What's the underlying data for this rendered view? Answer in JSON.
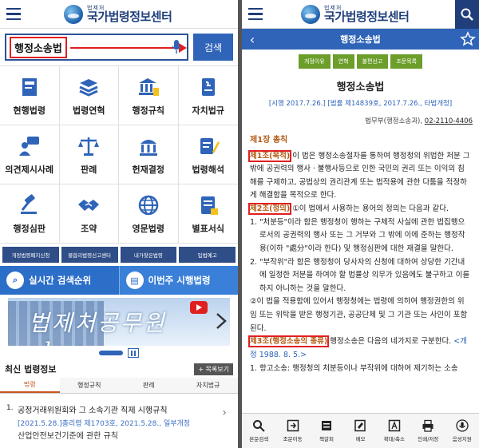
{
  "left": {
    "logo": {
      "sub": "법제처",
      "main": "국가법령정보센터"
    },
    "search": {
      "query": "행정소송법",
      "button": "검색"
    },
    "grid": [
      {
        "name": "current-law",
        "label": "현행법령",
        "icon": "law-book-icon"
      },
      {
        "name": "law-history",
        "label": "법령연혁",
        "icon": "stacked-books-icon"
      },
      {
        "name": "admin-rule",
        "label": "행정규칙",
        "icon": "building-icon"
      },
      {
        "name": "local-law",
        "label": "자치법규",
        "icon": "document-icon"
      },
      {
        "name": "opinion-case",
        "label": "의견제시사례",
        "icon": "speech-person-icon"
      },
      {
        "name": "precedent",
        "label": "판례",
        "icon": "scales-icon"
      },
      {
        "name": "constitutional",
        "label": "헌재결정",
        "icon": "court-icon"
      },
      {
        "name": "law-interpretation",
        "label": "법령해석",
        "icon": "pencil-doc-icon"
      },
      {
        "name": "admin-trial",
        "label": "행정심판",
        "icon": "gavel-icon"
      },
      {
        "name": "treaty",
        "label": "조약",
        "icon": "handshake-icon"
      },
      {
        "name": "english-law",
        "label": "영문법령",
        "icon": "globe-icon"
      },
      {
        "name": "appendix-form",
        "label": "별표서식",
        "icon": "form-icon"
      }
    ],
    "quick": [
      "개정법령폐지신청",
      "불합리법령신고센터",
      "내가찾은법령",
      "입법예고"
    ],
    "banners": [
      {
        "label": "실시간 검색순위",
        "icon": "search-icon"
      },
      {
        "label": "이번주 시행법령",
        "icon": "document-icon"
      }
    ],
    "vlog": {
      "text": "법제처공무원 vlog"
    },
    "latest": {
      "title": "최신 법령정보",
      "more": "+ 목록보기",
      "tabs": [
        "법령",
        "행정규칙",
        "판례",
        "자치법규"
      ],
      "items": [
        {
          "num": "1.",
          "title": "공정거래위원회와 그 소속기관 직제 시행규칙",
          "meta": "[2021.5.28.]총리령 제1703호, 2021.5.28., 일부개정"
        }
      ],
      "item2": "산업안전보건기준에 관한 규칙"
    }
  },
  "right": {
    "logo": {
      "sub": "법제처",
      "main": "국가법령정보센터"
    },
    "title_bar": "행정소송법",
    "tags": [
      "개정이유",
      "연혁",
      "불편신고",
      "조문목록"
    ],
    "law_title": "행정소송법",
    "law_meta": "[시행 2017.7.26.] [법률 제14839호, 2017.7.26., 타법개정]",
    "dept": "법무부(행정소송과), ",
    "phone": "02-2110-4406",
    "chapter": "제1장 총칙",
    "art1_label": "제1조(목적)",
    "art1_text": " 이 법은 행정소송절차를 통하여 행정청의 위법한 처분 그 밖에 공권력의 행사ㆍ불행사등으로 인한 국민의 권리 또는 이익의 침해를 구제하고, 공법상의 권리관계 또는 법적용에 관한 다툼을 적정하게 해결함을 목적으로 한다.",
    "art2_label": "제2조(정의)",
    "art2_text": " ①이 법에서 사용하는 용어의 정의는 다음과 같다.",
    "art2_item1": "1. \"처분등\"이라 함은 행정청이 행하는 구체적 사실에 관한 법집행으로서의 공권력의 행사 또는 그 거부와 그 밖에 이에 준하는 행정작용(이하 \"處分\"이라 한다) 및 행정심판에 대한 재결을 말한다.",
    "art2_item2": "2. \"부작위\"라 함은 행정청이 당사자의 신청에 대하여 상당한 기간내에 일정한 처분을 하여야 할 법률상 의무가 있음에도 불구하고 이를 하지 아니하는 것을 말한다.",
    "art2_para2": "②이 법을 적용함에 있어서 행정청에는 법령에 의하여 행정권한의 위임 또는 위탁을 받은 행정기관, 공공단체 및 그 기관 또는 사인이 포함된다.",
    "art3_label": "제3조(행정소송의 종류)",
    "art3_text": " 행정소송은 다음의 네가지로 구분한다. ",
    "art3_amend": "<개정 1988. 8. 5.>",
    "art3_item1": "1. 항고소송: 행정청의 처분등이나 부작위에 대하여 제기하는 소송",
    "toolbar": [
      {
        "name": "text-search",
        "label": "본문검색",
        "icon": "magnifier-icon"
      },
      {
        "name": "article-move",
        "label": "조문이동",
        "icon": "arrow-box-icon"
      },
      {
        "name": "folding",
        "label": "책갈피",
        "icon": "bookmark-icon"
      },
      {
        "name": "memo",
        "label": "메모",
        "icon": "memo-icon"
      },
      {
        "name": "zoom",
        "label": "확대/축소",
        "icon": "font-size-icon"
      },
      {
        "name": "print-save",
        "label": "인쇄/저장",
        "icon": "printer-icon"
      },
      {
        "name": "voice",
        "label": "음성지원",
        "icon": "microphone-icon"
      }
    ]
  }
}
